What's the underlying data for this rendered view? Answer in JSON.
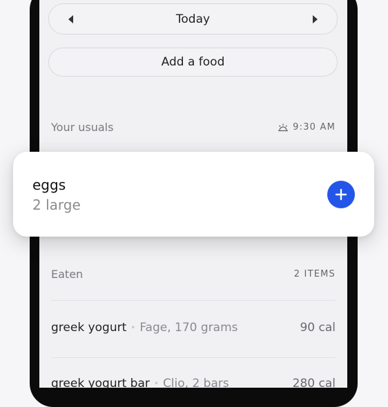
{
  "date_nav": {
    "label": "Today"
  },
  "add_food": {
    "label": "Add a food"
  },
  "usuals": {
    "title": "Your usuals",
    "time": "9:30 AM"
  },
  "card": {
    "name": "eggs",
    "amount": "2 large"
  },
  "eaten": {
    "title": "Eaten",
    "count": "2 ITEMS",
    "items": [
      {
        "name": "greek yogurt",
        "detail": "Fage, 170 grams",
        "cal": "90 cal"
      },
      {
        "name": "greek yogurt bar",
        "detail": "Clio, 2 bars",
        "cal": "280 cal"
      }
    ]
  },
  "colors": {
    "accent": "#2356e8"
  },
  "icons": [
    "caret-left-icon",
    "caret-right-icon",
    "sunrise-icon",
    "plus-icon"
  ]
}
